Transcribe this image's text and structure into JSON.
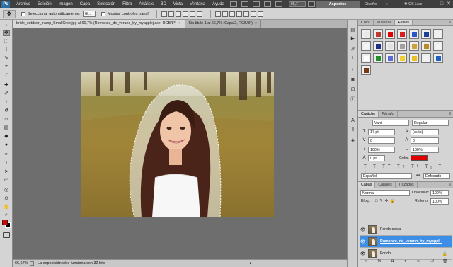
{
  "menubar": {
    "logo": "Ps",
    "items": [
      "Archivo",
      "Edición",
      "Imagen",
      "Capa",
      "Selección",
      "Filtro",
      "Análisis",
      "3D",
      "Vista",
      "Ventana",
      "Ayuda"
    ],
    "zoom": "66,7",
    "workspace_active": "Aspectos esenciales",
    "workspace_other": "Diseño",
    "workspace_more": "»",
    "cs_live": "CS Live",
    "minimize": "–",
    "restore": "□",
    "close": "✕"
  },
  "options": {
    "auto_select_label": "Seleccionar automáticamente:",
    "auto_select_value": "Gr...",
    "show_transform_label": "Mostrar controles transf."
  },
  "documents": {
    "tabs": [
      {
        "title": "bride_outdoor_tramp_SmallCrop.jpg al 66,7% (Romance_de_verano_by_myapplejuice, RGB/8*)",
        "close": "×"
      },
      {
        "title": "Sin título-1 al 66,7% (Capa 2, RGB/8*)",
        "close": "×"
      }
    ]
  },
  "status": {
    "zoom": "66,67%",
    "message": "La exposición sólo funciona con 32 bits"
  },
  "styles_panel": {
    "tabs": [
      "Color",
      "Muestras",
      "Estilos"
    ],
    "swatches": [
      "#e8e8e8",
      "#c0392b",
      "#e00000",
      "#d62020",
      "#2a56c6",
      "#1d3f9a",
      "#f0f0f0",
      "#f5f5f5",
      "#1c2d8a",
      "#e0e0e0",
      "#a0a0a0",
      "#c9a23a",
      "#b88a2a",
      "#f3f3f3",
      "#ffffff",
      "#1f8f2a",
      "#5b6cd8",
      "#f0d030",
      "#e8c020",
      "#f2f2f2",
      "#1e5fbf",
      "#7a3b12"
    ]
  },
  "character_panel": {
    "tabs": [
      "Carácter",
      "Párrafo"
    ],
    "font_family": "Vani",
    "font_style": "Regular",
    "font_size": "17 pt",
    "leading": "(Auto)",
    "kerning": "0",
    "tracking": "0",
    "vertical_scale": "100%",
    "horizontal_scale": "100%",
    "baseline_shift": "0 pt",
    "color_label": "Color:",
    "color_value": "#e00000",
    "language": "Español",
    "antialias_icon": "aa",
    "antialias": "Enfocado"
  },
  "layers_panel": {
    "tabs": [
      "Capas",
      "Canales",
      "Trazados"
    ],
    "blend_mode": "Normal",
    "opacity_label": "Opacidad:",
    "opacity": "100%",
    "lock_label": "Bloq.:",
    "fill_label": "Relleno:",
    "fill": "100%",
    "layers": [
      {
        "name": "Fondo copia",
        "selected": false,
        "locked": false
      },
      {
        "name": "Romance_de_verano_by_myappl...",
        "selected": true,
        "locked": false
      },
      {
        "name": "Fondo",
        "selected": false,
        "locked": true
      }
    ]
  }
}
